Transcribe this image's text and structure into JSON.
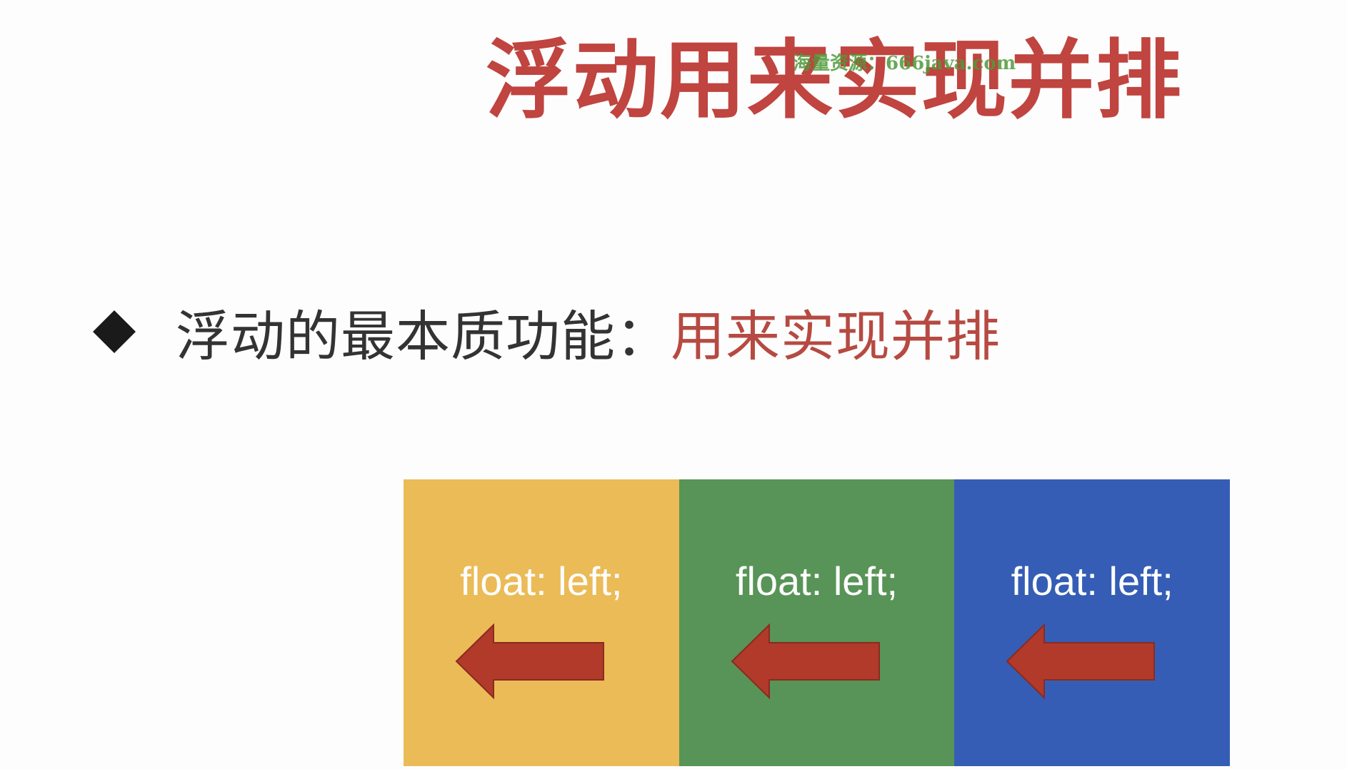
{
  "slide": {
    "title": "浮动用来实现并排",
    "watermark": "海量资源：666java.com"
  },
  "bullet": {
    "icon": "diamond-bullet-icon",
    "label": "浮动的最本质功能：",
    "highlight": "用来实现并排"
  },
  "colors": {
    "title": "#c0443f",
    "highlight": "#b64a42",
    "arrow": "#b13a2b",
    "arrow_outline": "#8a2b1f"
  },
  "boxes": [
    {
      "label": "float: left;",
      "color": "#ebbb57",
      "icon": "left-arrow-icon"
    },
    {
      "label": "float: left;",
      "color": "#589457",
      "icon": "left-arrow-icon"
    },
    {
      "label": "float: left;",
      "color": "#355db5",
      "icon": "left-arrow-icon"
    }
  ]
}
